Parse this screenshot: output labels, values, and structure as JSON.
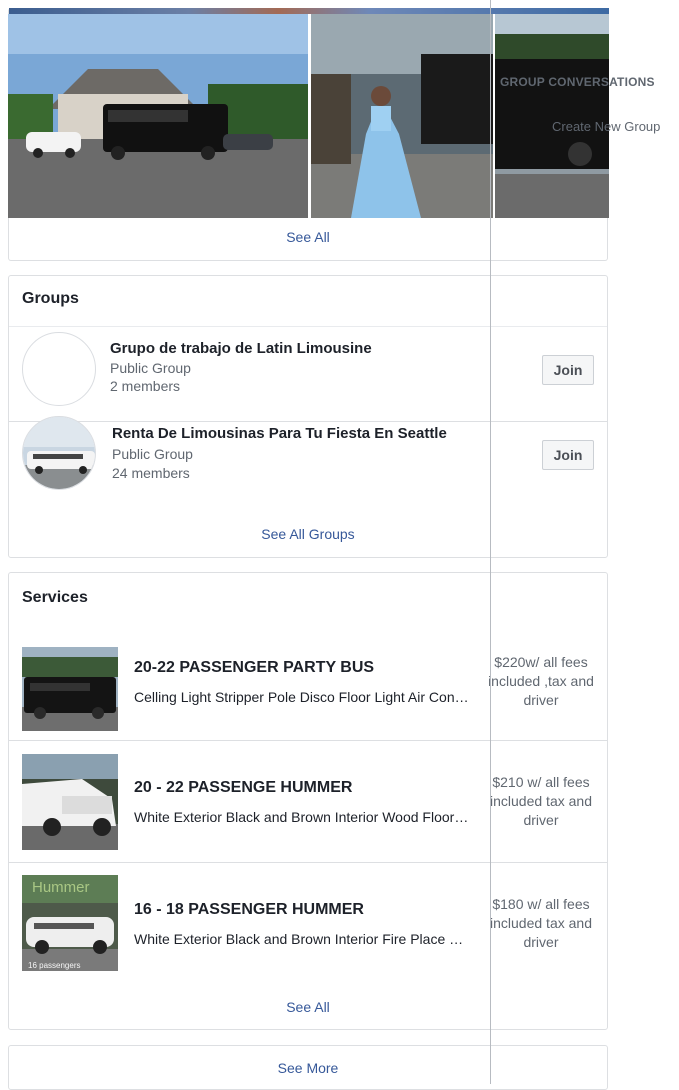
{
  "photos": {
    "see_all_label": "See All"
  },
  "groups": {
    "title": "Groups",
    "items": [
      {
        "name": "Grupo de trabajo de Latin Limousine",
        "type": "Public Group",
        "members": "2 members",
        "join_label": "Join"
      },
      {
        "name": "Renta De Limousinas Para Tu Fiesta En Seattle",
        "type": "Public Group",
        "members": "24 members",
        "join_label": "Join"
      }
    ],
    "see_all_label": "See All Groups"
  },
  "services": {
    "title": "Services",
    "items": [
      {
        "name": "20-22 PASSENGER PARTY BUS",
        "description": "Celling Light Stripper Pole Disco Floor Light Air Conditioning Sound System",
        "price": "$220w/ all fees included ,tax and driver"
      },
      {
        "name": "20 - 22 PASSENGE HUMMER",
        "description": "White Exterior Black and Brown Interior Wood Floor Light Show",
        "price": "$210 w/ all fees included tax and driver"
      },
      {
        "name": "16 - 18 PASSENGER HUMMER",
        "description": "White Exterior Black and Brown Interior Fire Place Light Show",
        "price": "$180 w/ all fees included tax and driver",
        "thumb_caption_top": "Hummer",
        "thumb_caption_bottom": "16 passengers"
      }
    ],
    "see_all_label": "See All"
  },
  "see_more_label": "See More",
  "sidebar": {
    "group_conversations_heading": "GROUP CONVERSATIONS",
    "create_new_group_label": "Create New Group"
  },
  "colors": {
    "link": "#365899",
    "border": "#dddfe2",
    "secondary_text": "#606770"
  }
}
